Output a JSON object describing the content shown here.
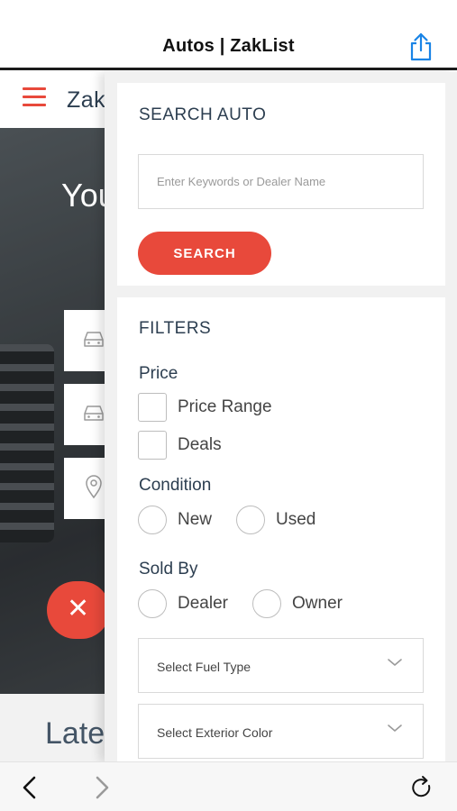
{
  "browser": {
    "title": "Autos | ZakList",
    "share_icon": "share-icon",
    "back_icon": "chevron-left-icon",
    "forward_icon": "chevron-right-icon",
    "reload_icon": "reload-icon"
  },
  "background_page": {
    "logo_text": "Zak",
    "hero_title": "You",
    "latest_heading": "Lates",
    "menu_icon": "hamburger-icon",
    "close_icon": "close-icon"
  },
  "search": {
    "heading": "SEARCH AUTO",
    "placeholder": "Enter Keywords or Dealer Name",
    "value": "",
    "button_label": "SEARCH"
  },
  "filters": {
    "heading": "FILTERS",
    "price": {
      "label": "Price",
      "options": [
        "Price Range",
        "Deals"
      ]
    },
    "condition": {
      "label": "Condition",
      "options": [
        "New",
        "Used"
      ]
    },
    "sold_by": {
      "label": "Sold By",
      "options": [
        "Dealer",
        "Owner"
      ]
    },
    "selects": [
      "Select Fuel Type",
      "Select Exterior Color"
    ]
  },
  "colors": {
    "accent": "#e8493b",
    "heading": "#2c3e50",
    "text": "#444444"
  }
}
